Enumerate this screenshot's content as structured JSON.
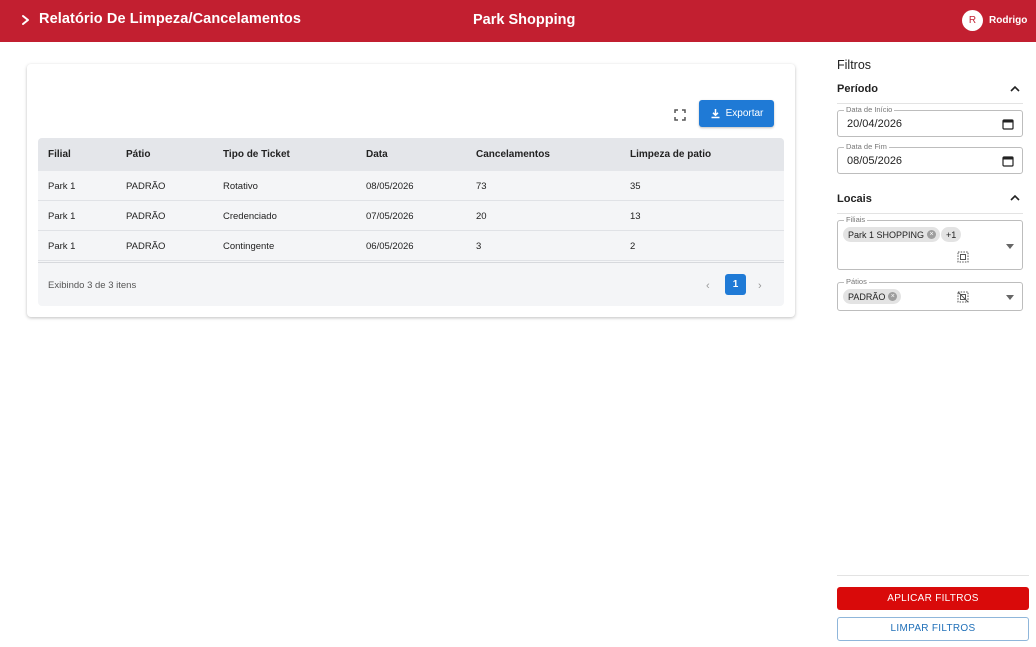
{
  "header": {
    "title": "Relatório De Limpeza/Cancelamentos",
    "center_title": "Park Shopping",
    "user_initial": "R",
    "user_name": "Rodrigo",
    "color": "#c21f30"
  },
  "toolbar": {
    "export_label": "Exportar"
  },
  "table": {
    "columns": [
      "Filial",
      "Pátio",
      "Tipo de Ticket",
      "Data",
      "Cancelamentos",
      "Limpeza de patio"
    ],
    "rows": [
      [
        "Park 1",
        "PADRÃO",
        "Rotativo",
        "08/05/2026",
        "73",
        "35"
      ],
      [
        "Park 1",
        "PADRÃO",
        "Credenciado",
        "07/05/2026",
        "20",
        "13"
      ],
      [
        "Park 1",
        "PADRÃO",
        "Contingente",
        "06/05/2026",
        "3",
        "2"
      ]
    ],
    "footer_text": "Exibindo 3 de 3 itens",
    "current_page": "1"
  },
  "filters": {
    "title": "Filtros",
    "periodo": {
      "heading": "Período",
      "start_label": "Data de Início",
      "start_value": "20/04/2026",
      "end_label": "Data de Fim",
      "end_value": "08/05/2026"
    },
    "locais": {
      "heading": "Locais",
      "filiais_label": "Filiais",
      "filiais_chip": "Park 1 SHOPPING",
      "filiais_more": "+1",
      "patios_label": "Pátios",
      "patios_chip": "PADRÃO"
    },
    "apply_label": "APLICAR FILTROS",
    "clear_label": "LIMPAR FILTROS"
  },
  "colors": {
    "primary_red": "#c21f30",
    "apply_red": "#d90a0a",
    "accent_blue": "#1f7ad6"
  }
}
